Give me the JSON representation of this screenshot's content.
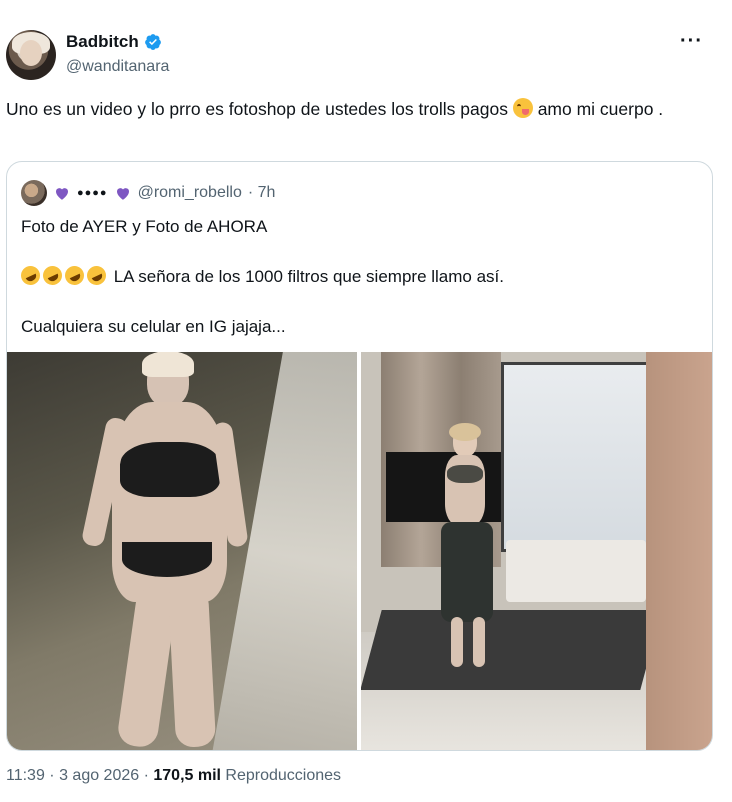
{
  "author": {
    "display_name": "Badbitch",
    "handle": "@wanditanara",
    "verified_icon": "verified-badge-icon",
    "verified_color": "#1d9bf0"
  },
  "tweet": {
    "text_part1": "Uno es un video y lo prro es fotoshop de ustedes los trolls pagos ",
    "emoji": "face-savoring-food-emoji",
    "text_part2": " amo mi cuerpo ."
  },
  "quoted": {
    "handle": "@romi_robello",
    "time": "· 7h",
    "line1": "Foto de AYER  y Foto de AHORA",
    "line2_text": " LA señora de los 1000 filtros que siempre llamo así.",
    "line2_emoji_count": 4,
    "line3": "Cualquiera su celular en IG jajaja...",
    "heart_color": "#7e57c2"
  },
  "footer": {
    "time": "11:39 · 3 ago 2026 · ",
    "views_count": "170,5 mil",
    "views_label": " Reproducciones"
  },
  "more_label": "···"
}
